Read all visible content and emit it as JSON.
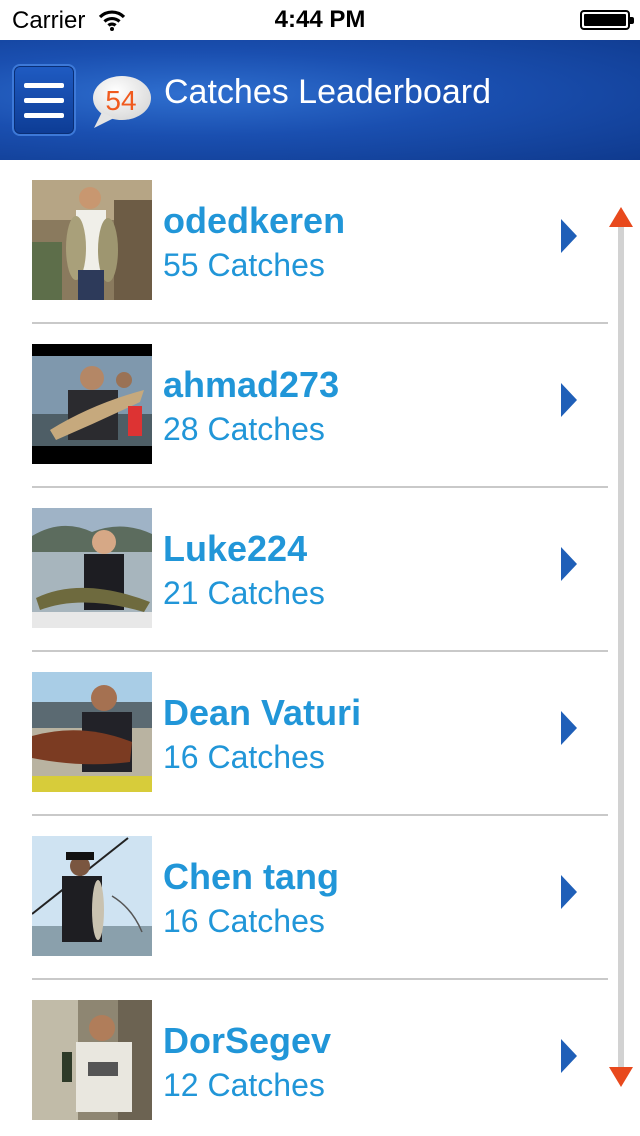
{
  "status_bar": {
    "carrier": "Carrier",
    "time": "4:44 PM"
  },
  "nav": {
    "title": "Catches Leaderboard",
    "count_badge": "54"
  },
  "leaderboard": [
    {
      "name": "odedkeren",
      "catches": "55 Catches"
    },
    {
      "name": "ahmad273",
      "catches": "28 Catches"
    },
    {
      "name": "Luke224",
      "catches": "21 Catches"
    },
    {
      "name": "Dean Vaturi",
      "catches": "16 Catches"
    },
    {
      "name": "Chen tang",
      "catches": "16 Catches"
    },
    {
      "name": "DorSegev",
      "catches": "12 Catches"
    }
  ],
  "icons": {
    "menu": "hamburger-menu-icon",
    "row_arrow": "chevron-right-icon",
    "scroll_up": "scroll-up-arrow-icon",
    "scroll_down": "scroll-down-arrow-icon"
  },
  "colors": {
    "nav_background": "#1a4fb0",
    "accent_text": "#2196d8",
    "badge_number": "#f05a1e",
    "scroll_arrow": "#e8491d",
    "divider": "#c9c9c9"
  }
}
